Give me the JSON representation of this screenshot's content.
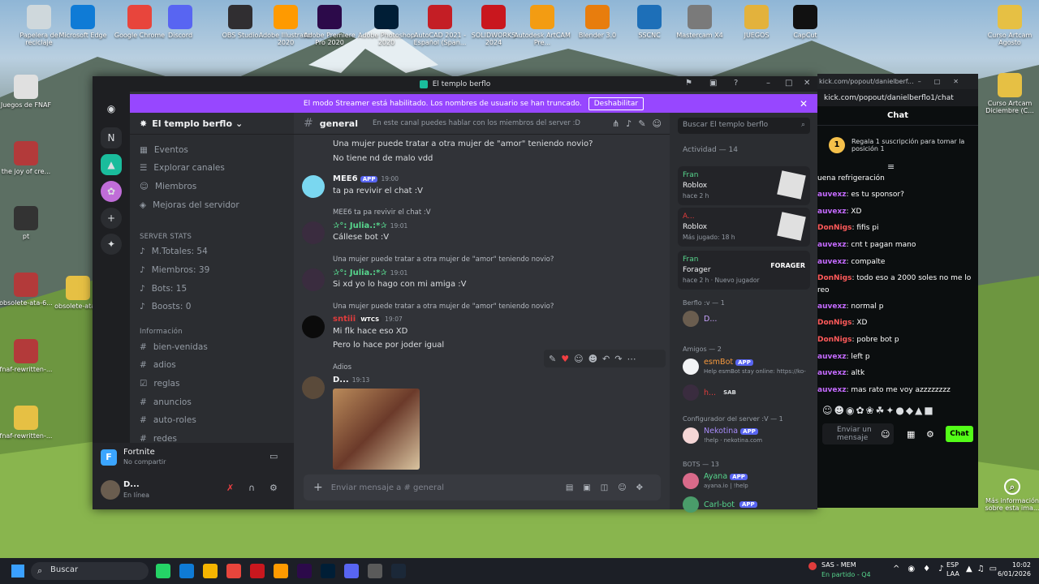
{
  "desktop": {
    "icons": [
      {
        "label": "Papelera de reciclaje",
        "color": "#cfd8dc"
      },
      {
        "label": "Microsoft Edge",
        "color": "#0f7bd6"
      },
      {
        "label": "Google Chrome",
        "color": "#e8453c"
      },
      {
        "label": "Discord",
        "color": "#5865f2"
      },
      {
        "label": "OBS Studio",
        "color": "#302e31"
      },
      {
        "label": "Adobe Illustrator 2020",
        "color": "#ff9a00"
      },
      {
        "label": "Adobe Premiere Pro 2020",
        "color": "#2c0a4a"
      },
      {
        "label": "Adobe Photoshop 2020",
        "color": "#001e36"
      },
      {
        "label": "AutoCAD 2021 - Español (Span...",
        "color": "#c41e25"
      },
      {
        "label": "SOLIDWORKS 2024",
        "color": "#c9171e"
      },
      {
        "label": "Autodesk ArtCAM Pre...",
        "color": "#f39c12"
      },
      {
        "label": "Blender 3.0",
        "color": "#e87d0d"
      },
      {
        "label": "SSCNC",
        "color": "#1d6fb8"
      },
      {
        "label": "Mastercam X4",
        "color": "#7a7a7a"
      },
      {
        "label": "JUEGOS",
        "color": "#e3b23c"
      },
      {
        "label": "CapCut",
        "color": "#111111"
      }
    ],
    "left_icons": [
      {
        "label": "Juegos de FNAF",
        "color": "#e0e0e0"
      },
      {
        "label": "the joy of cre...",
        "color": "#b33a3a"
      },
      {
        "label": "pt",
        "color": "#333333"
      },
      {
        "label": "obsolete-ata-6...",
        "color": "#b33a3a"
      },
      {
        "label": "obsolete-ata...",
        "color": "#e6c044"
      },
      {
        "label": "fnaf-rewritten-...",
        "color": "#b33a3a"
      },
      {
        "label": "fnaf-rewritten-...",
        "color": "#e6c044"
      }
    ],
    "right_icons": [
      {
        "label": "Curso Artcam Agosto",
        "color": "#e6c044"
      },
      {
        "label": "Curso Artcam Diciembre (C...",
        "color": "#e6c044"
      }
    ],
    "info_label": "Más información sobre esta ima..."
  },
  "discord": {
    "window_title": "El templo berflo",
    "streamer_text": "El modo Streamer está habilitado. Los nombres de usuario se han truncado.",
    "streamer_button": "Deshabilitar",
    "server_name": "El templo berflo",
    "nav": [
      "Eventos",
      "Explorar canales",
      "Miembros",
      "Mejoras del servidor"
    ],
    "stats_category": "SERVER STATS",
    "stats": [
      "M.Totales: 54",
      "Miembros: 39",
      "Bots: 15",
      "Boosts: 0"
    ],
    "info_category": "Información",
    "channels": [
      "bien-venidas",
      "adios",
      "reglas",
      "anuncios",
      "auto-roles",
      "redes"
    ],
    "activity_game": "Fortnite",
    "activity_sub": "No compartir",
    "user_name": "D...",
    "user_status": "En línea",
    "channel_name": "general",
    "channel_topic": "En este canal puedes hablar con los miembros del server :D",
    "search_placeholder": "Buscar El templo berflo",
    "input_placeholder": "Enviar mensaje a #  general",
    "messages": {
      "m0a": "Una mujer puede tratar a otra mujer de \"amor\" teniendo novio?",
      "m0b": "No tiene nd de malo vdd",
      "mee6_name": "MEE6",
      "mee6_time": "19:00",
      "mee6_text": "ta pa revivir el chat :V",
      "r1": "MEE6 ta pa revivir el chat :V",
      "u1_name": "✰°: Julia.:*✰",
      "u1_time": "19:01",
      "u1_text": "Cállese bot :V",
      "r2": "Una mujer puede tratar a otra mujer de \"amor\" teniendo novio?",
      "u2_time": "19:01",
      "u2_text": "Si xd yo lo hago con mi amiga :V",
      "r3": "Una mujer puede tratar a otra mujer de \"amor\" teniendo novio?",
      "u3_name": "sntiii",
      "u3_tag": "WTCS",
      "u3_time": "19:07",
      "u3_text1": "Mi flk hace eso XD",
      "u3_text2": "Pero lo hace por joder igual",
      "r4": "Adios",
      "u4_name": "D...",
      "u4_time": "19:13"
    },
    "members": {
      "activity_title": "Actividad — 14",
      "cards": [
        {
          "user": "Fran",
          "game": "Roblox",
          "time": "hace 2 h"
        },
        {
          "user": "A...",
          "game": "Roblox",
          "time": "Más jugado: 18 h"
        },
        {
          "user": "Fran",
          "game": "Forager",
          "time": "hace 2 h  ·  Nuevo jugador"
        }
      ],
      "g1": "Berflo :v — 1",
      "g1_user": "D...",
      "g2": "Amigos — 2",
      "g2_u1": "esmBot",
      "g2_u1_sub": "Help esmBot stay online: https://ko-",
      "g2_u2": "h...",
      "g2_u2_tag": "SAB",
      "g3": "Configurador del server :V — 1",
      "g3_u1": "Nekotina",
      "g3_u1_sub": "!help · nekotina.com",
      "g4": "BOTS — 13",
      "g4_u1": "Ayana",
      "g4_u1_sub": "ayana.io | !help",
      "g4_u2": "Carl-bot",
      "app_tag": "APP"
    }
  },
  "kick": {
    "tab_url": "kick.com/popout/danielberf...",
    "url": "kick.com/popout/danielberflo1/chat",
    "chat_title": "Chat",
    "gift_text": "Regala 1 suscripción para tomar la posición 1",
    "gift_rank": "1",
    "lines": [
      {
        "name": "",
        "text": "uena refrigeración"
      },
      {
        "name": "auvexz",
        "text": ": es tu sponsor?"
      },
      {
        "name": "auvexz",
        "text": ": XD"
      },
      {
        "name": "DonNigs",
        "text": ": fifis pi"
      },
      {
        "name": "auvexz",
        "text": ": cnt t pagan mano"
      },
      {
        "name": "auvexz",
        "text": ": compalte"
      },
      {
        "name": "DonNigs",
        "text": ": todo eso a 2000 soles no me lo"
      },
      {
        "name": "",
        "text": "reo"
      },
      {
        "name": "auvexz",
        "text": ": normal p"
      },
      {
        "name": "DonNigs",
        "text": ": XD"
      },
      {
        "name": "DonNigs",
        "text": ": pobre bot p"
      },
      {
        "name": "auvexz",
        "text": ": left p"
      },
      {
        "name": "auvexz",
        "text": ": altk"
      },
      {
        "name": "auvexz",
        "text": ": mas rato me voy azzzzzzzz"
      }
    ],
    "input_placeholder": "Enviar un mensaje",
    "chat_button": "Chat"
  },
  "taskbar": {
    "search_placeholder": "Buscar",
    "game_title": "SAS - MEM",
    "game_sub": "En partido - Q4",
    "lang": "ESP",
    "lang2": "LAA",
    "time": "10:02",
    "date": "6/01/2026"
  }
}
